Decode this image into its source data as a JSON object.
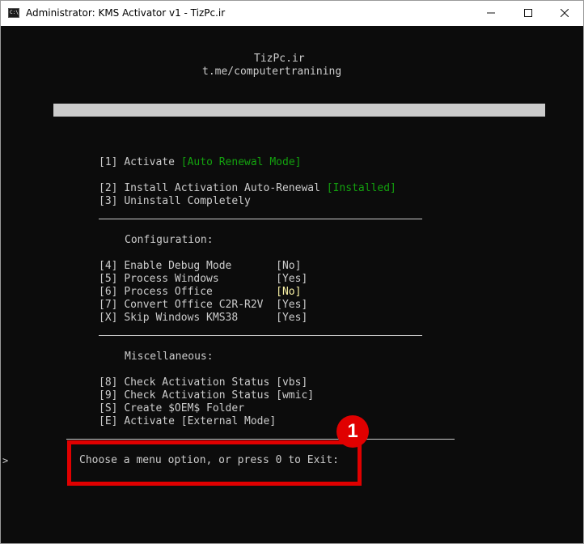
{
  "window": {
    "title": "Administrator:  KMS Activator v1 - TizPc.ir",
    "app_icon_glyph": "C:\\",
    "controls": [
      "minimize-icon",
      "maximize-icon",
      "close-icon"
    ]
  },
  "header": {
    "site": "TizPc.ir",
    "channel": "t.me/computertranining"
  },
  "menu": {
    "item1": {
      "key": "[1]",
      "label": "Activate ",
      "status": "[Auto Renewal Mode]",
      "status_color": "#13a10e"
    },
    "item2": {
      "key": "[2]",
      "label": "Install Activation Auto-Renewal ",
      "status": "[Installed]",
      "status_color": "#13a10e"
    },
    "item3": {
      "key": "[3]",
      "label": "Uninstall Completely"
    },
    "config_heading": "Configuration:",
    "config": [
      {
        "key": "[4]",
        "label": "Enable Debug Mode       ",
        "value": "[No]"
      },
      {
        "key": "[5]",
        "label": "Process Windows         ",
        "value": "[Yes]"
      },
      {
        "key": "[6]",
        "label": "Process Office          ",
        "value": "[No]",
        "value_color": "#f9f1a5"
      },
      {
        "key": "[7]",
        "label": "Convert Office C2R-R2V  ",
        "value": "[Yes]"
      },
      {
        "key": "[X]",
        "label": "Skip Windows KMS38      ",
        "value": "[Yes]"
      }
    ],
    "misc_heading": "Miscellaneous:",
    "misc": [
      {
        "key": "[8]",
        "label": "Check Activation Status ",
        "value": "[vbs]"
      },
      {
        "key": "[9]",
        "label": "Check Activation Status ",
        "value": "[wmic]"
      },
      {
        "key": "[S]",
        "label": "Create $OEM$ Folder"
      },
      {
        "key": "[E]",
        "label": "Activate [External Mode]"
      }
    ]
  },
  "prompt": {
    "caret": ">",
    "text": "Choose a menu option, or press 0 to Exit:"
  },
  "annotation": {
    "badge_number": "1",
    "color": "#e00000"
  }
}
